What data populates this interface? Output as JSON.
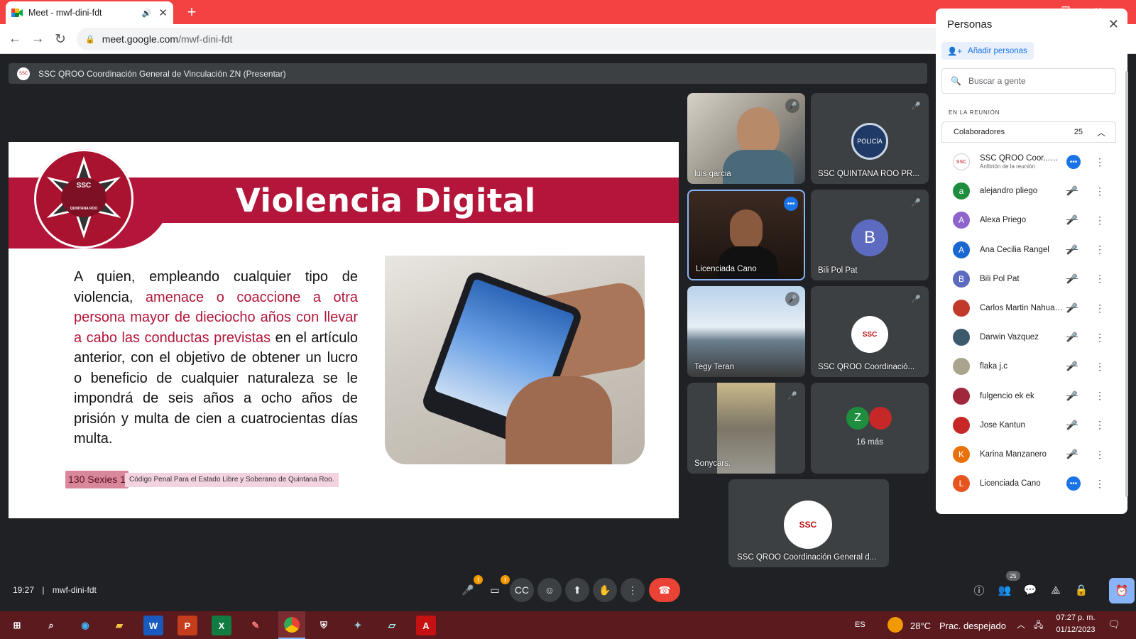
{
  "browser": {
    "tab_title": "Meet - mwf-dini-fdt",
    "url_host": "meet.google.com",
    "url_path": "/mwf-dini-fdt"
  },
  "presenting_bar": {
    "text": "SSC QROO Coordinación General de Vinculación ZN (Presentar)"
  },
  "slide": {
    "title": "Violencia Digital",
    "logo_text": "SSC",
    "logo_sub": "QUINTANA ROO",
    "body_1": "A quien, empleando cualquier tipo de violencia, ",
    "body_red": "amenace o coaccione a otra persona mayor de dieciocho años con llevar a cabo las conductas previstas",
    "body_2": " en el artículo anterior, con el objetivo de obtener un lucro o beneficio de cualquier naturaleza se le impondrá de seis años a ocho años de prisión y multa de cien a cuatrocientas días multa.",
    "citation_article": "130 Sexies 1",
    "citation_source": "Código Penal Para el Estado Libre y Soberano de Quintana Roo."
  },
  "tiles": [
    {
      "name": "luis garcia"
    },
    {
      "name": "SSC QUINTANA ROO PR..."
    },
    {
      "name": "Licenciada Cano"
    },
    {
      "name": "Bili Pol Pat",
      "initial": "B"
    },
    {
      "name": "Tegy Teran"
    },
    {
      "name": "SSC QROO Coordinació..."
    },
    {
      "name": "Sonycars."
    },
    {
      "name": "16 más",
      "initial": "Z"
    },
    {
      "name": "SSC QROO Coordinación General d..."
    }
  ],
  "panel": {
    "title": "Personas",
    "add_people": "Añadir personas",
    "search_placeholder": "Buscar a gente",
    "section": "EN LA REUNIÓN",
    "group_label": "Colaboradores",
    "group_count": "25",
    "people": [
      {
        "name": "SSC QROO Coor...",
        "tag": "(Tú)",
        "sub": "Anfitrión de la reunión",
        "color": "#ffffff"
      },
      {
        "name": "alejandro pliego",
        "initial": "a",
        "color": "#1e8e3e"
      },
      {
        "name": "Alexa Priego",
        "initial": "A",
        "color": "#8e63ce"
      },
      {
        "name": "Ana Cecilia Rangel",
        "initial": "A",
        "color": "#1967d2"
      },
      {
        "name": "Bili Pol Pat",
        "initial": "B",
        "color": "#5c6bc0"
      },
      {
        "name": "Carlos Martin Nahuat ...",
        "initial": "",
        "color": "#c0392b"
      },
      {
        "name": "Darwin Vazquez",
        "initial": "",
        "color": "#3c5a6b"
      },
      {
        "name": "flaka j.c",
        "initial": "",
        "color": "#a8a58c"
      },
      {
        "name": "fulgencio ek ek",
        "initial": "",
        "color": "#a0283c"
      },
      {
        "name": "Jose Kantun",
        "initial": "",
        "color": "#c62828"
      },
      {
        "name": "Karina Manzanero",
        "initial": "K",
        "color": "#e8710a"
      },
      {
        "name": "Licenciada Cano",
        "initial": "L",
        "color": "#e8541e"
      }
    ]
  },
  "bottom": {
    "time": "19:27",
    "meeting_code": "mwf-dini-fdt",
    "participants_count": "25"
  },
  "taskbar": {
    "lang": "ES",
    "weather_temp": "28°C",
    "weather_text": "Prac. despejado",
    "clock_time": "07:27 p. m.",
    "clock_date": "01/12/2023"
  }
}
